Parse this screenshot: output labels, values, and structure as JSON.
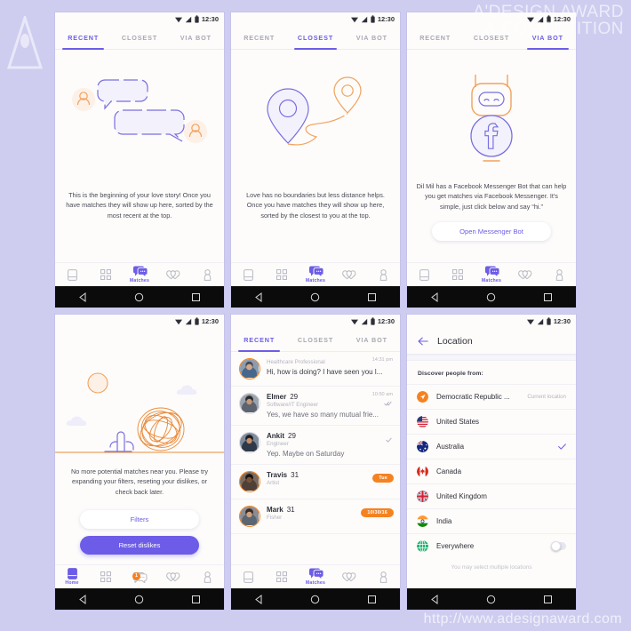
{
  "watermark": {
    "line1": "A'DESIGN AWARD",
    "line2": "& COMPETITION",
    "url": "http://www.adesignaward.com"
  },
  "status_bar": {
    "time": "12:30"
  },
  "tabs": {
    "recent": "RECENT",
    "closest": "CLOSEST",
    "via_bot": "VIA BOT"
  },
  "bottom_nav": {
    "items": [
      {
        "icon": "cards-icon",
        "label": ""
      },
      {
        "icon": "grid-icon",
        "label": ""
      },
      {
        "icon": "matches-chat-icon",
        "label": "Matches"
      },
      {
        "icon": "hearts-icon",
        "label": ""
      },
      {
        "icon": "profile-icon",
        "label": ""
      }
    ],
    "home_label": "Home",
    "matches_label": "Matches",
    "badge_count": "1"
  },
  "system_nav": {
    "back": "back-icon",
    "home": "home-icon",
    "recents": "recents-icon"
  },
  "screen1": {
    "active_tab": "RECENT",
    "illustration": "chat-bubbles-illustration",
    "blurb": "This is the beginning of your love story! Once you have matches they will show up here, sorted by the most recent at the top."
  },
  "screen2": {
    "active_tab": "CLOSEST",
    "illustration": "map-pins-illustration",
    "blurb": "Love has no boundaries but less distance helps. Once you have matches they will show up here, sorted by the closest to you at the top."
  },
  "screen3": {
    "active_tab": "VIA BOT",
    "illustration": "robot-facebook-illustration",
    "blurb": "Dil Mil has a Facebook Messenger Bot that can help you get matches via Facebook Messenger. It's simple, just click below and say “hi.”",
    "button": "Open Messenger Bot"
  },
  "screen4": {
    "illustration": "desert-tumbleweed-illustration",
    "blurb": "No more potential matches near you. Please try expanding your filters, reseting your dislikes, or check back later.",
    "filters_button": "Filters",
    "reset_button": "Reset dislikes"
  },
  "screen5": {
    "active_tab": "RECENT",
    "messages": [
      {
        "name": "",
        "age": "",
        "job": "Healthcare Professional",
        "preview": "Hi, how is doing? I have seen you l...",
        "time": "14:31 pm",
        "badge": "",
        "ticks": "",
        "unread": true,
        "ring": "orange"
      },
      {
        "name": "Elmer",
        "age": "29",
        "job": "Software/IT Engineer",
        "preview": "Yes, we have so many mutual frie...",
        "time": "10:50 am",
        "badge": "",
        "ticks": "double-check-icon",
        "unread": false,
        "ring": "plain"
      },
      {
        "name": "Ankit",
        "age": "29",
        "job": "Engineer",
        "preview": "Yep. Maybe on Saturday",
        "time": "",
        "badge": "",
        "ticks": "single-check-icon",
        "unread": false,
        "ring": "plain"
      },
      {
        "name": "Travis",
        "age": "31",
        "job": "Artist",
        "preview": "",
        "time": "",
        "badge": "Tue",
        "ticks": "",
        "unread": false,
        "ring": "orange"
      },
      {
        "name": "Mark",
        "age": "31",
        "job": "Fisher",
        "preview": "",
        "time": "",
        "badge": "10/30/16",
        "ticks": "",
        "unread": false,
        "ring": "orange"
      }
    ]
  },
  "screen6": {
    "back_icon": "back-arrow-icon",
    "title": "Location",
    "section_label": "Discover people from:",
    "note": "You may select multiple locations",
    "rows": [
      {
        "flag": "current-location-icon",
        "name": "Democratic Republic ...",
        "sub": "Current location",
        "selected": false,
        "toggle": false
      },
      {
        "flag": "flag-us-icon",
        "name": "United States",
        "sub": "",
        "selected": false,
        "toggle": false
      },
      {
        "flag": "flag-au-icon",
        "name": "Australia",
        "sub": "",
        "selected": true,
        "toggle": false
      },
      {
        "flag": "flag-ca-icon",
        "name": "Canada",
        "sub": "",
        "selected": false,
        "toggle": false
      },
      {
        "flag": "flag-uk-icon",
        "name": "United Kingdom",
        "sub": "",
        "selected": false,
        "toggle": false
      },
      {
        "flag": "flag-in-icon",
        "name": "India",
        "sub": "",
        "selected": false,
        "toggle": false
      },
      {
        "flag": "globe-icon",
        "name": "Everywhere",
        "sub": "",
        "selected": false,
        "toggle": true
      }
    ]
  },
  "colors": {
    "accent_purple": "#6c5ce7",
    "accent_orange": "#f58220",
    "background": "#cecdf0",
    "screen_bg": "#fdfcfa"
  }
}
